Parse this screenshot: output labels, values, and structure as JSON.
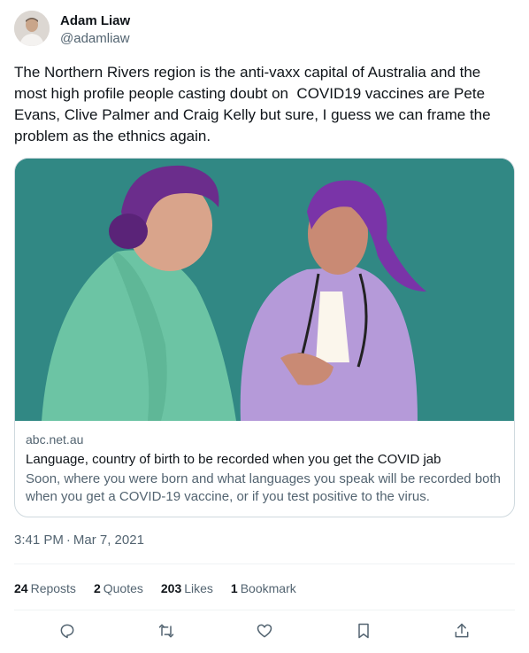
{
  "author": {
    "display_name": "Adam Liaw",
    "handle": "@adamliaw"
  },
  "tweet": {
    "text": "The Northern Rivers region is the anti-vaxx capital of Australia and the most high profile people casting doubt on  COVID19 vaccines are Pete Evans, Clive Palmer and Craig Kelly but sure, I guess we can frame the problem as the ethnics again."
  },
  "card": {
    "domain": "abc.net.au",
    "title": "Language, country of birth to be recorded when you get the COVID jab",
    "description": "Soon, where you were born and what languages you speak will be recorded both when you get a COVID-19 vaccine, or if you test positive to the virus."
  },
  "meta": {
    "time": "3:41 PM",
    "separator": "·",
    "date": "Mar 7, 2021"
  },
  "stats": {
    "reposts_count": "24",
    "reposts_label": "Reposts",
    "quotes_count": "2",
    "quotes_label": "Quotes",
    "likes_count": "203",
    "likes_label": "Likes",
    "bookmarks_count": "1",
    "bookmarks_label": "Bookmark"
  },
  "actions": {
    "icons": [
      "reply-icon",
      "repost-icon",
      "like-icon",
      "bookmark-icon",
      "share-icon"
    ]
  },
  "colors": {
    "text_primary": "#0f1419",
    "text_secondary": "#536471",
    "border": "#cfd9de",
    "card_background_teal": "#2f8683"
  }
}
